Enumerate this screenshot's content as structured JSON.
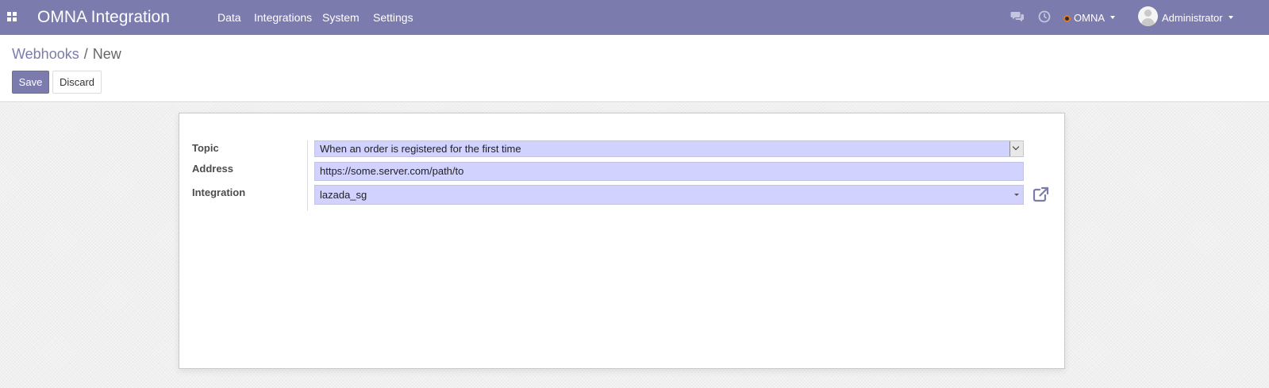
{
  "navbar": {
    "brand": "OMNA Integration",
    "menu": [
      {
        "label": "Data"
      },
      {
        "label": "Integrations"
      },
      {
        "label": "System"
      },
      {
        "label": "Settings"
      }
    ],
    "icons": [
      "apps-icon",
      "chat-icon",
      "clock-icon"
    ],
    "company": "OMNA",
    "user": "Administrator",
    "background_color": "#7c7bad"
  },
  "breadcrumb": {
    "parent": "Webhooks",
    "separator": "/",
    "current": "New"
  },
  "buttons": {
    "save": "Save",
    "discard": "Discard"
  },
  "form": {
    "topic": {
      "label": "Topic",
      "value": "When an order is registered for the first time"
    },
    "address": {
      "label": "Address",
      "value": "https://some.server.com/path/to"
    },
    "integration": {
      "label": "Integration",
      "value": "lazada_sg"
    },
    "required_field_color": "#d2d2ff",
    "external_link_icon": "external-link-icon"
  }
}
